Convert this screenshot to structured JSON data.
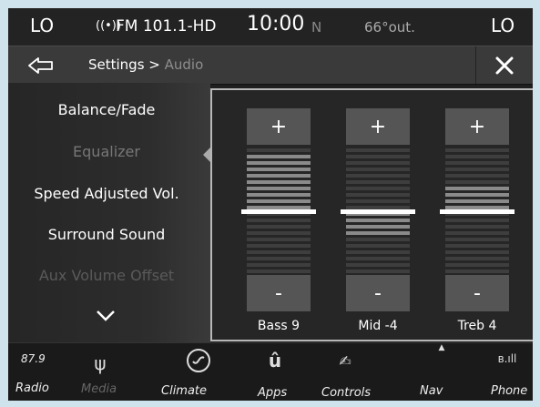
{
  "status": {
    "left": "LO",
    "radio_icon": "antenna-icon",
    "station": "FM 101.1-HD",
    "time": "10:00",
    "compass": "N",
    "temp": "66°out.",
    "right": "LO"
  },
  "titlebar": {
    "back_icon": "back-arrow-icon",
    "crumb_main": "Settings > ",
    "crumb_dim": "Audio",
    "close_icon": "close-icon"
  },
  "menu": {
    "items": [
      {
        "label": "Balance/Fade",
        "state": "normal"
      },
      {
        "label": "Equalizer",
        "state": "selected"
      },
      {
        "label": "Speed Adjusted Vol.",
        "state": "normal"
      },
      {
        "label": "Surround Sound",
        "state": "normal"
      },
      {
        "label": "Aux Volume Offset",
        "state": "disabled"
      }
    ],
    "more_icon": "chevron-down-icon"
  },
  "equalizer": {
    "bands": [
      {
        "label": "Bass 9",
        "value": 9,
        "plus": "+",
        "minus": "-"
      },
      {
        "label": "Mid -4",
        "value": -4,
        "plus": "+",
        "minus": "-"
      },
      {
        "label": "Treb 4",
        "value": 4,
        "plus": "+",
        "minus": "-"
      }
    ],
    "range": [
      -9,
      9
    ]
  },
  "dock": {
    "radio_freq": "87.9",
    "items": [
      {
        "label": "Radio",
        "icon": "radio-icon"
      },
      {
        "label": "Media",
        "icon": "usb-icon",
        "dim": true
      },
      {
        "label": "Climate",
        "icon": "climate-icon"
      },
      {
        "label": "Apps",
        "icon": "apps-icon"
      },
      {
        "label": "Controls",
        "icon": "controls-icon"
      },
      {
        "label": "Nav",
        "icon": "nav-icon"
      },
      {
        "label": "Phone",
        "icon": "phone-icon"
      }
    ]
  },
  "colors": {
    "accent": "#ffffff",
    "panel": "#262626",
    "muted": "#8e8e8e"
  }
}
